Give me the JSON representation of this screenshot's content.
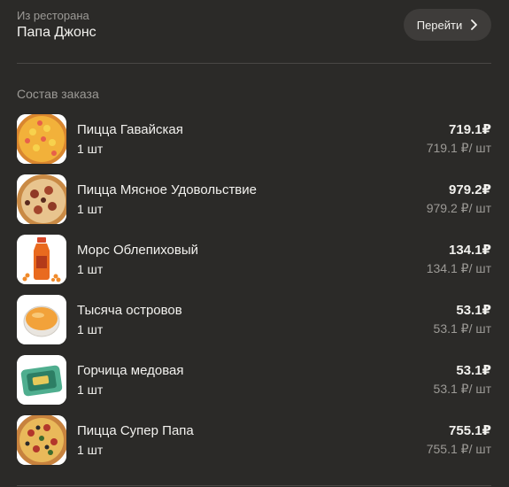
{
  "header": {
    "from_label": "Из ресторана",
    "restaurant_name": "Папа Джонс",
    "goto_label": "Перейти",
    "goto_icon": "chevron-right-icon"
  },
  "section_title": "Состав заказа",
  "items": [
    {
      "name": "Пицца Гавайская",
      "qty": "1 шт",
      "total": "719.1₽",
      "unit_price": "719.1 ₽/ шт",
      "image": "hawaiian-pizza"
    },
    {
      "name": "Пицца Мясное Удовольствие",
      "qty": "1 шт",
      "total": "979.2₽",
      "unit_price": "979.2 ₽/ шт",
      "image": "meat-pizza"
    },
    {
      "name": "Морс Облепиховый",
      "qty": "1 шт",
      "total": "134.1₽",
      "unit_price": "134.1 ₽/ шт",
      "image": "sea-buckthorn-drink"
    },
    {
      "name": "Тысяча островов",
      "qty": "1 шт",
      "total": "53.1₽",
      "unit_price": "53.1 ₽/ шт",
      "image": "thousand-island-sauce"
    },
    {
      "name": "Горчица медовая",
      "qty": "1 шт",
      "total": "53.1₽",
      "unit_price": "53.1 ₽/ шт",
      "image": "honey-mustard-sauce"
    },
    {
      "name": "Пицца Супер Папа",
      "qty": "1 шт",
      "total": "755.1₽",
      "unit_price": "755.1 ₽/ шт",
      "image": "super-papa-pizza"
    }
  ],
  "colors": {
    "background": "#2b2a28",
    "button_bg": "#3e3c3a",
    "text_primary": "#f2f1ee",
    "text_secondary": "#9c9a96"
  }
}
